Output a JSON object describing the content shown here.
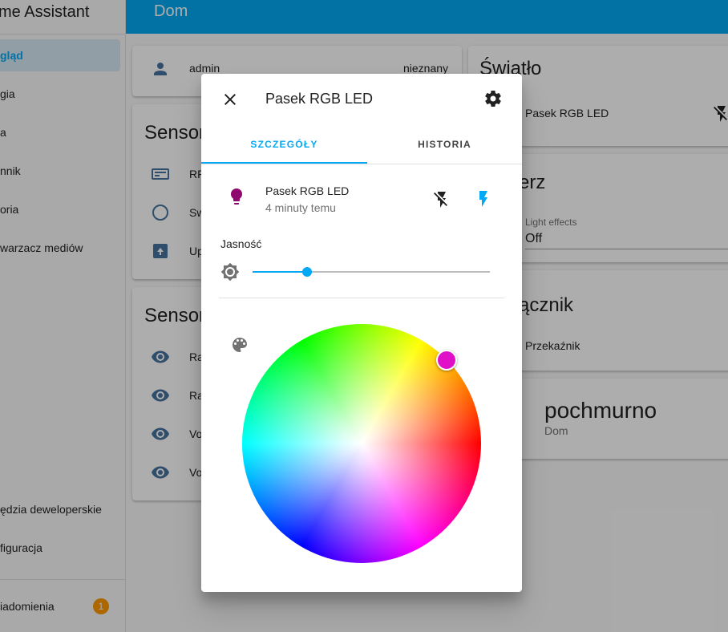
{
  "sidebar": {
    "title": "me Assistant",
    "items": [
      {
        "label": "gląd",
        "active": true
      },
      {
        "label": "gia"
      },
      {
        "label": "a"
      },
      {
        "label": "nnik"
      },
      {
        "label": "oria"
      },
      {
        "label": "warzacz mediów"
      }
    ],
    "bottom_items": [
      {
        "label": "ędzia deweloperskie"
      },
      {
        "label": "figuracja"
      }
    ],
    "notifications": {
      "label": "iadomienia",
      "count": "1"
    }
  },
  "header": {
    "title": "Dom"
  },
  "cards": {
    "person": {
      "name": "admin",
      "state": "nieznany"
    },
    "sensor1": {
      "title": "Sensor",
      "rows": [
        "RF",
        "Sw",
        "Up"
      ]
    },
    "sensor2": {
      "title": "Sensor",
      "rows": [
        "Ra",
        "Ra",
        "Vo",
        "Vo"
      ]
    },
    "light": {
      "title": "Światło",
      "entity": "Pasek RGB LED"
    },
    "effects": {
      "title": "erz",
      "label": "Light effects",
      "value": "Off"
    },
    "switch": {
      "title": "ącznik",
      "entity": "Przekaźnik"
    },
    "weather": {
      "state": "pochmurno",
      "location": "Dom"
    }
  },
  "dialog": {
    "title": "Pasek RGB LED",
    "tabs": [
      {
        "label": "SZCZEGÓŁY",
        "active": true
      },
      {
        "label": "HISTORIA",
        "active": false
      }
    ],
    "entity": {
      "name": "Pasek RGB LED",
      "last_changed": "4 minuty temu"
    },
    "brightness": {
      "label": "Jasność",
      "value_fraction": 0.23
    },
    "color_hex": "#e010c8"
  },
  "colors": {
    "accent": "#03a9f4",
    "icon": "#44739e",
    "bulb": "#8e0a6e"
  }
}
